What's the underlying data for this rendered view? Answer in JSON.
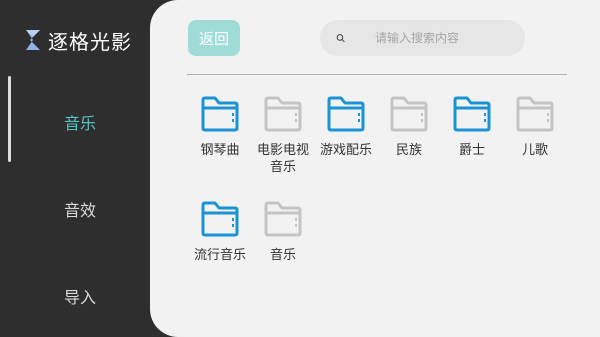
{
  "app": {
    "title": "逐格光影"
  },
  "sidebar": {
    "items": [
      {
        "label": "音乐",
        "active": true
      },
      {
        "label": "音效",
        "active": false
      },
      {
        "label": "导入",
        "active": false
      }
    ]
  },
  "toolbar": {
    "back_label": "返回"
  },
  "search": {
    "placeholder": "请输入搜索内容",
    "value": ""
  },
  "colors": {
    "accent": "#56c2c0",
    "folder_active": "#1a93d4",
    "folder_inactive": "#c4c4c4"
  },
  "folders": [
    {
      "label": "钢琴曲",
      "active": true
    },
    {
      "label": "电影电视音乐",
      "active": false
    },
    {
      "label": "游戏配乐",
      "active": true
    },
    {
      "label": "民族",
      "active": false
    },
    {
      "label": "爵士",
      "active": true
    },
    {
      "label": "儿歌",
      "active": false
    },
    {
      "label": "流行音乐",
      "active": true
    },
    {
      "label": "音乐",
      "active": false
    }
  ]
}
